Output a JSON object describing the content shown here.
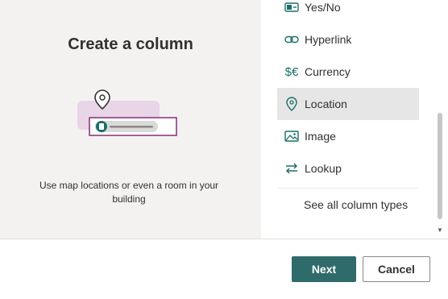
{
  "panel": {
    "title": "Create a column",
    "description": "Use map locations or even a room in your building"
  },
  "column_types": [
    {
      "label": "Yes/No",
      "icon": "yes-no-icon"
    },
    {
      "label": "Hyperlink",
      "icon": "link-icon"
    },
    {
      "label": "Currency",
      "icon": "currency-icon",
      "glyph": "$€"
    },
    {
      "label": "Location",
      "icon": "location-pin-icon",
      "selected": true
    },
    {
      "label": "Image",
      "icon": "image-icon"
    },
    {
      "label": "Lookup",
      "icon": "lookup-arrows-icon"
    }
  ],
  "see_all_label": "See all column types",
  "footer": {
    "next_label": "Next",
    "cancel_label": "Cancel"
  },
  "colors": {
    "accent": "#2e6b6a",
    "icon_teal": "#1b6e67",
    "selected_bg": "#e6e6e6",
    "illustration_purple": "#862c7d",
    "illustration_pink": "#e8d5e6"
  }
}
